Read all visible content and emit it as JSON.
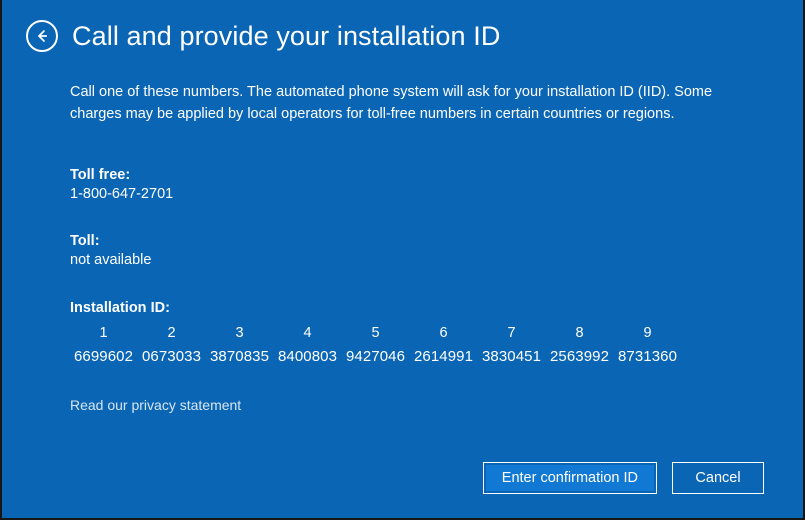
{
  "window": {
    "background_color": "#0a66b5",
    "border_color": "#161616"
  },
  "header": {
    "back_icon": "back-arrow-circle-icon",
    "title": "Call and provide your installation ID"
  },
  "main": {
    "intro": "Call one of these numbers. The automated phone system will ask for your installation ID (IID). Some charges may be applied by local operators for toll-free numbers in certain countries or regions.",
    "toll_free": {
      "label": "Toll free:",
      "value": "1-800-647-2701"
    },
    "toll": {
      "label": "Toll:",
      "value": "not available"
    },
    "installation_id": {
      "label": "Installation ID:",
      "column_indexes": [
        "1",
        "2",
        "3",
        "4",
        "5",
        "6",
        "7",
        "8",
        "9"
      ],
      "groups": [
        "6699602",
        "0673033",
        "3870835",
        "8400803",
        "9427046",
        "2614991",
        "3830451",
        "2563992",
        "8731360"
      ]
    },
    "privacy_link": "Read our privacy statement"
  },
  "footer": {
    "primary_button": "Enter confirmation ID",
    "secondary_button": "Cancel",
    "primary_button_color": "#1179d4"
  }
}
